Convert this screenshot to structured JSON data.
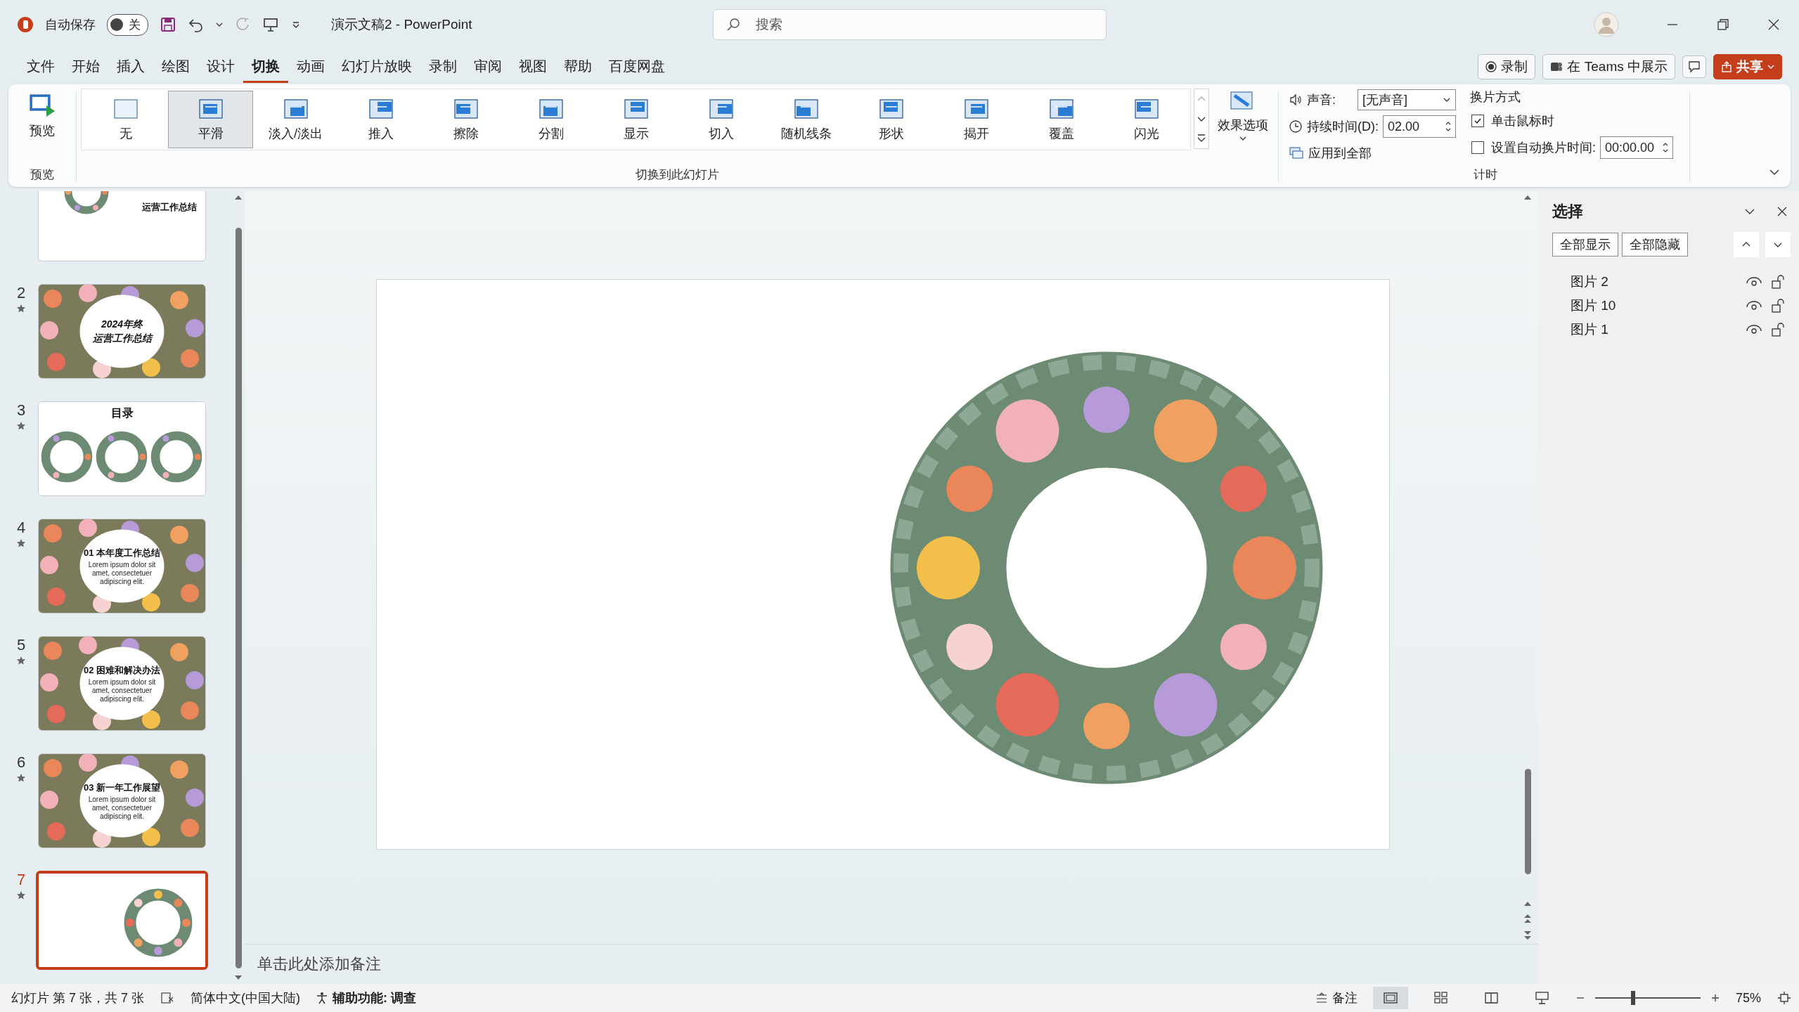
{
  "titlebar": {
    "autosave_label": "自动保存",
    "autosave": {
      "on": false,
      "label": "关"
    },
    "title": "演示文稿2 - PowerPoint",
    "search": {
      "placeholder": "搜索"
    }
  },
  "menu": {
    "tabs": [
      {
        "label": "文件",
        "selected": false
      },
      {
        "label": "开始",
        "selected": false
      },
      {
        "label": "插入",
        "selected": false
      },
      {
        "label": "绘图",
        "selected": false
      },
      {
        "label": "设计",
        "selected": false
      },
      {
        "label": "切换",
        "selected": true
      },
      {
        "label": "动画",
        "selected": false
      },
      {
        "label": "幻灯片放映",
        "selected": false
      },
      {
        "label": "录制",
        "selected": false
      },
      {
        "label": "审阅",
        "selected": false
      },
      {
        "label": "视图",
        "selected": false
      },
      {
        "label": "帮助",
        "selected": false
      },
      {
        "label": "百度网盘",
        "selected": false
      }
    ],
    "actions": [
      {
        "kind": "record",
        "label": "录制"
      },
      {
        "kind": "teams",
        "label": "在 Teams 中展示"
      },
      {
        "kind": "comment"
      },
      {
        "kind": "share",
        "label": "共享"
      }
    ]
  },
  "ribbon": {
    "preview": {
      "button": "预览",
      "group": "预览"
    },
    "transitions": [
      {
        "label": "无",
        "selected": false
      },
      {
        "label": "平滑",
        "selected": true
      },
      {
        "label": "淡入/淡出",
        "selected": false
      },
      {
        "label": "推入",
        "selected": false
      },
      {
        "label": "擦除",
        "selected": false
      },
      {
        "label": "分割",
        "selected": false
      },
      {
        "label": "显示",
        "selected": false
      },
      {
        "label": "切入",
        "selected": false
      },
      {
        "label": "随机线条",
        "selected": false
      },
      {
        "label": "形状",
        "selected": false
      },
      {
        "label": "揭开",
        "selected": false
      },
      {
        "label": "覆盖",
        "selected": false
      },
      {
        "label": "闪光",
        "selected": false
      }
    ],
    "gallery_group": "切换到此幻灯片",
    "effect_options": "效果选项",
    "timing": {
      "sound_label": "声音:",
      "sound_value": "[无声音]",
      "duration_label": "持续时间(D):",
      "duration_value": "02.00",
      "apply_all": "应用到全部",
      "advance_title": "换片方式",
      "on_click": {
        "label": "单击鼠标时",
        "checked": true
      },
      "auto_advance": {
        "label": "设置自动换片时间:",
        "checked": false,
        "value": "00:00.00"
      },
      "group": "计时"
    }
  },
  "slides": [
    {
      "kind": "summary",
      "selected": false,
      "title": [
        "运营工作总结"
      ]
    },
    {
      "kind": "title",
      "number": "2",
      "selected": false,
      "title": [
        "2024年终",
        "运营工作总结"
      ]
    },
    {
      "kind": "agenda",
      "number": "3",
      "selected": false,
      "title": [
        "目录"
      ]
    },
    {
      "kind": "section",
      "number": "4",
      "selected": false,
      "title": [
        "01 本年度工作总结"
      ],
      "body": "Lorem ipsum dolor sit amet, consectetuer adipiscing elit."
    },
    {
      "kind": "section",
      "number": "5",
      "selected": false,
      "title": [
        "02 困难和解决办法"
      ],
      "body": "Lorem ipsum dolor sit amet, consectetuer adipiscing elit."
    },
    {
      "kind": "section",
      "number": "6",
      "selected": false,
      "title": [
        "03 新一年工作展望"
      ],
      "body": "Lorem ipsum dolor sit amet, consectetuer adipiscing elit."
    },
    {
      "kind": "wreath",
      "number": "7",
      "selected": true
    }
  ],
  "editor": {
    "notes_placeholder": "单击此处添加备注"
  },
  "selection_pane": {
    "title": "选择",
    "show_all": "全部显示",
    "hide_all": "全部隐藏",
    "items": [
      {
        "label": "图片 2"
      },
      {
        "label": "图片 10"
      },
      {
        "label": "图片 1"
      }
    ]
  },
  "status_bar": {
    "slide_info": "幻灯片 第 7 张，共 7 张",
    "language": "简体中文(中国大陆)",
    "accessibility": "辅助功能: 调查",
    "notes": "备注",
    "views": [
      {
        "kind": "normal",
        "selected": true
      },
      {
        "kind": "sorter",
        "selected": false
      },
      {
        "kind": "reading",
        "selected": false
      },
      {
        "kind": "slideshow",
        "selected": false
      }
    ],
    "zoom": {
      "level": 0.36,
      "reading": "75%"
    }
  }
}
